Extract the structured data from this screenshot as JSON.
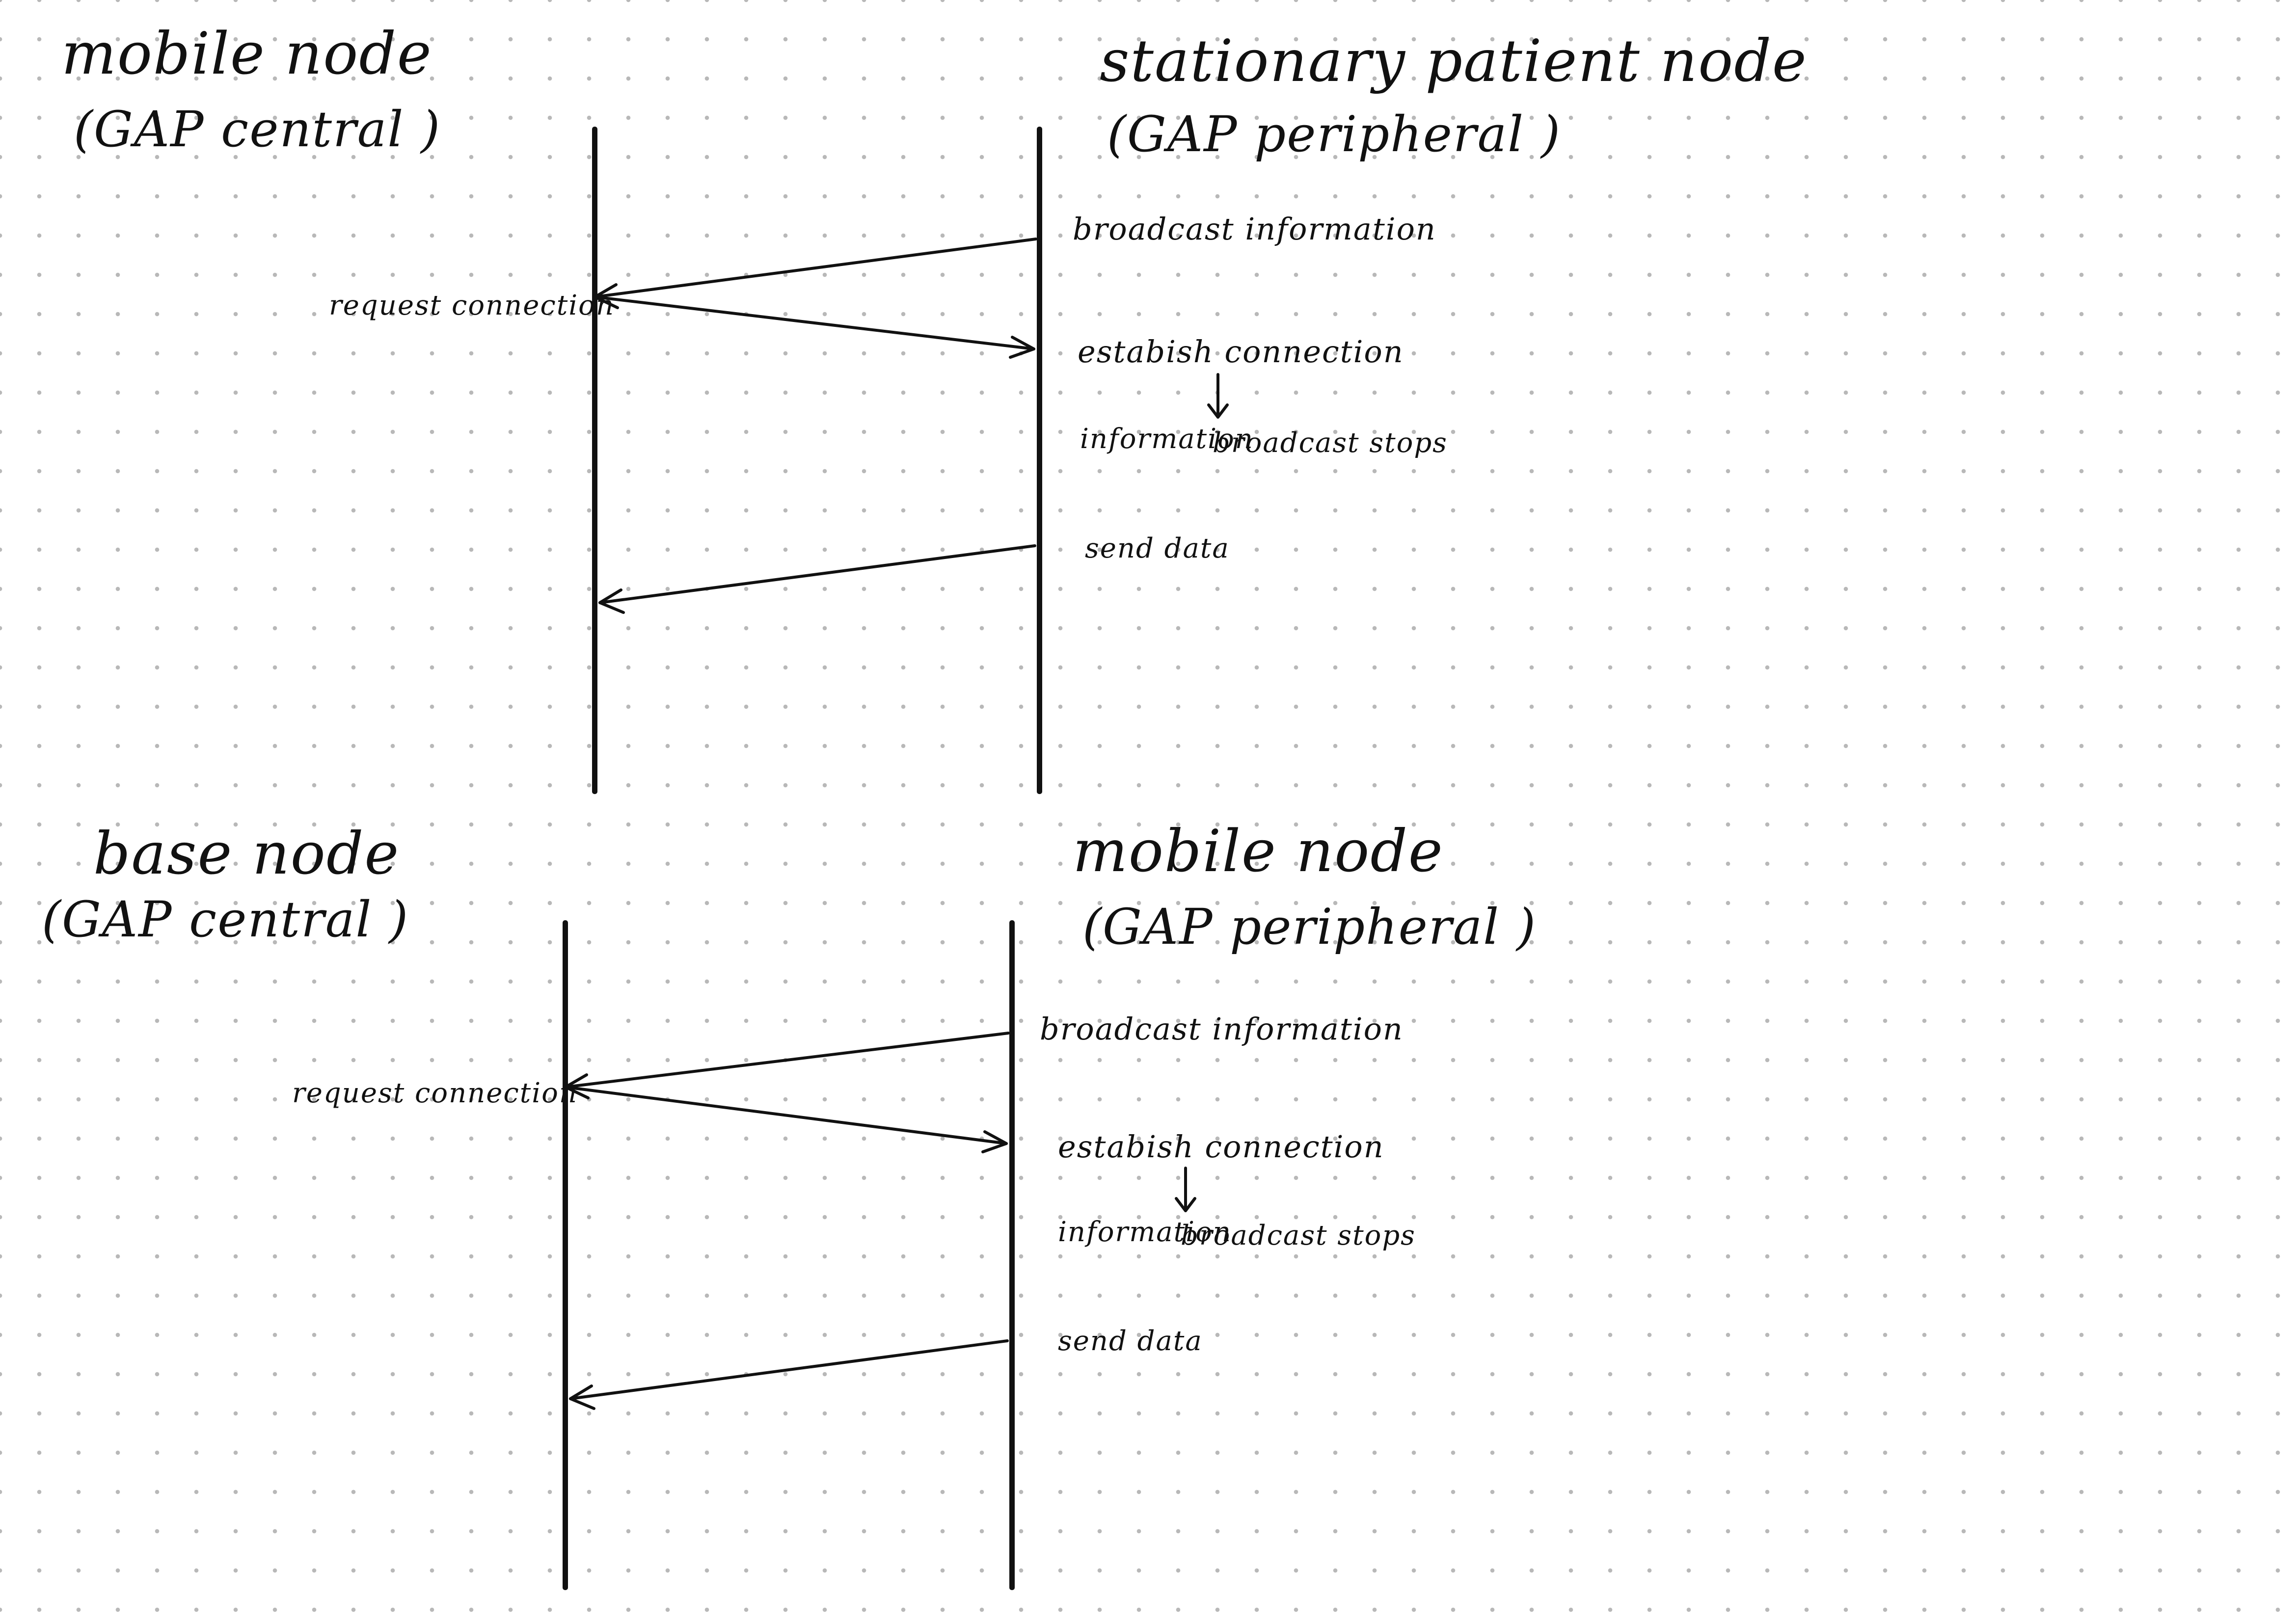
{
  "diagrams": [
    {
      "left_participant": {
        "name": "mobile node",
        "role": "(GAP central   )"
      },
      "right_participant": {
        "name": "stationary patient node",
        "role": "(GAP peripheral  )"
      },
      "messages": {
        "broadcast": "broadcast information",
        "request": "request connection",
        "establish": "estabish connection",
        "stops_left": "information",
        "stops_right": "broadcast stops",
        "send": "send data"
      }
    },
    {
      "left_participant": {
        "name": "base node",
        "role": "(GAP central   )"
      },
      "right_participant": {
        "name": "mobile node",
        "role": "(GAP peripheral  )"
      },
      "messages": {
        "broadcast": "broadcast information",
        "request": "request connection",
        "establish": "estabish connection",
        "stops_left": "information",
        "stops_right": "broadcast stops",
        "send": "send data"
      }
    }
  ]
}
